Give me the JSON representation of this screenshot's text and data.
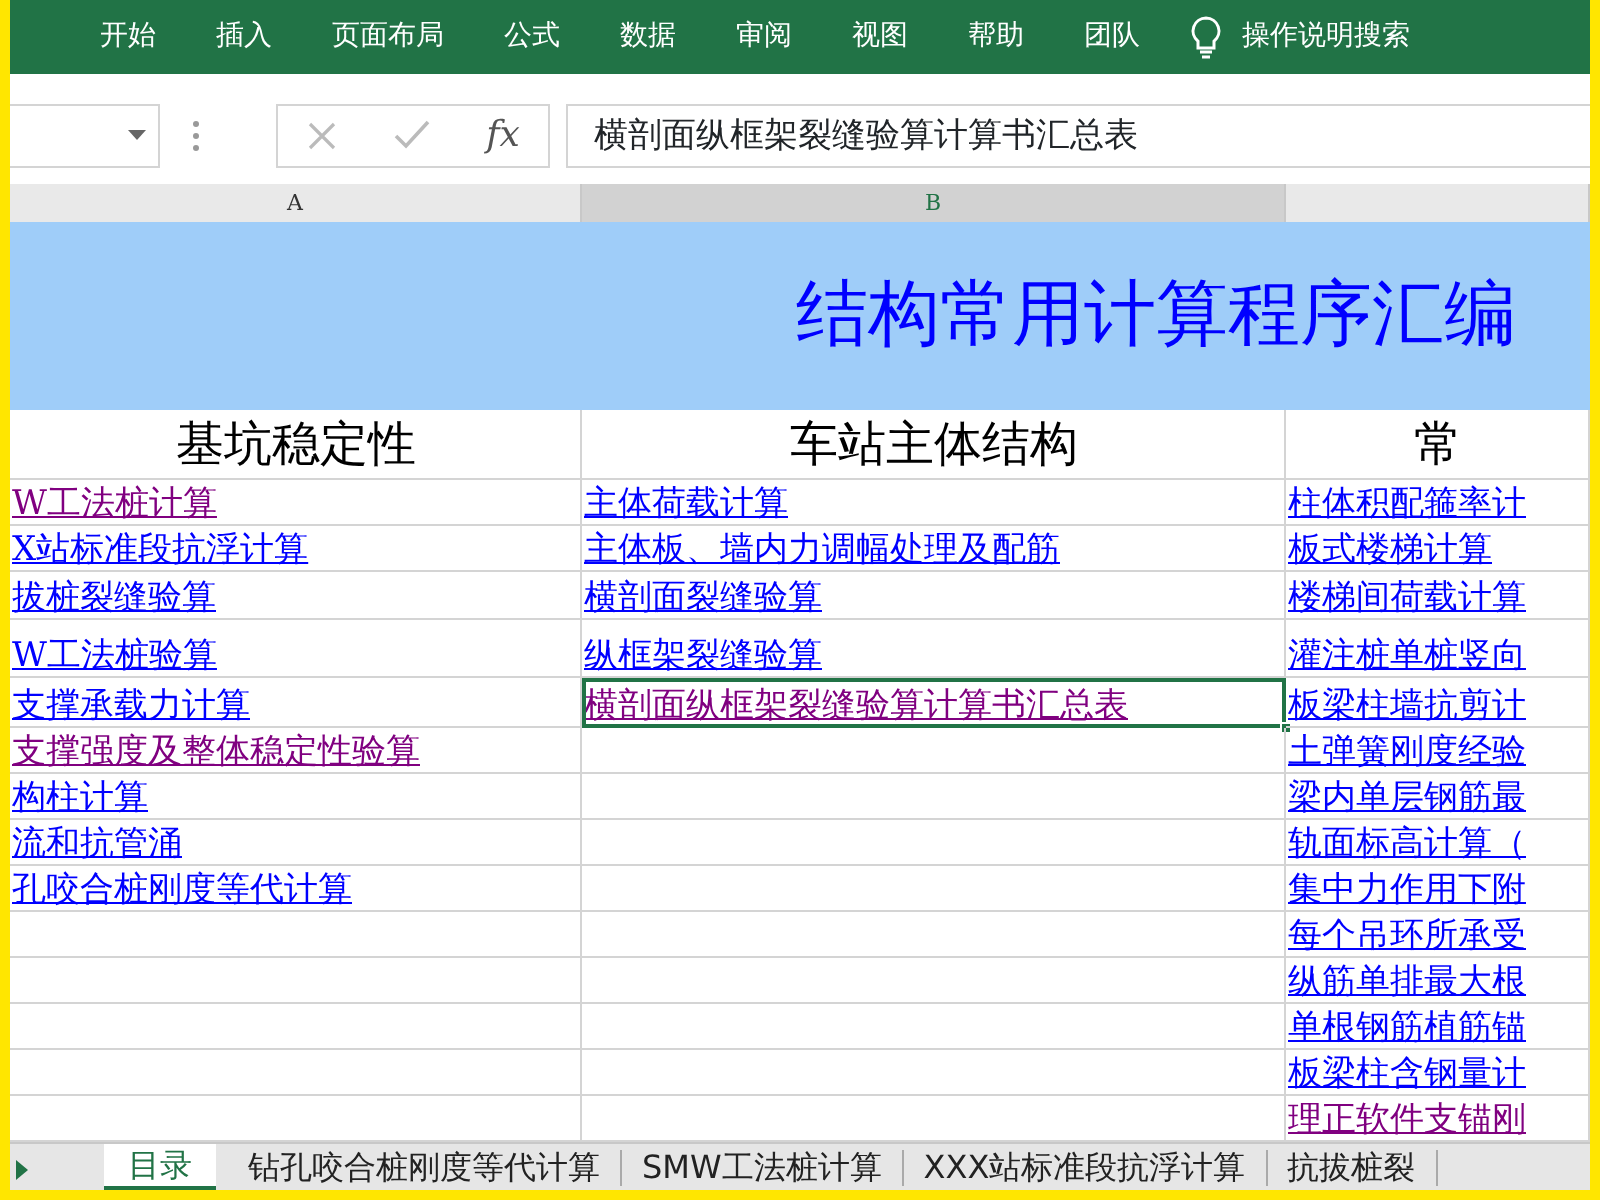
{
  "ribbon": {
    "tabs": [
      {
        "label": "开始"
      },
      {
        "label": "插入"
      },
      {
        "label": "页面布局"
      },
      {
        "label": "公式"
      },
      {
        "label": "数据"
      },
      {
        "label": "审阅"
      },
      {
        "label": "视图"
      },
      {
        "label": "帮助"
      },
      {
        "label": "团队"
      }
    ],
    "search": "操作说明搜索"
  },
  "formula_bar": {
    "function_label": "fx",
    "formula": "横剖面纵框架裂缝验算计算书汇总表"
  },
  "column_headers": [
    {
      "label": "A",
      "selected": false
    },
    {
      "label": "B",
      "selected": true
    }
  ],
  "title": "结构常用计算程序汇编",
  "section_headers": [
    "基坑稳定性",
    "车站主体结构",
    "常"
  ],
  "rows": [
    [
      {
        "text": "W工法桩计算",
        "visited": true,
        "selected": false
      },
      {
        "text": "主体荷载计算",
        "visited": false,
        "selected": false
      },
      {
        "text": "柱体积配箍率计",
        "visited": false,
        "selected": false
      }
    ],
    [
      {
        "text": "X站标准段抗浮计算",
        "visited": false,
        "selected": false
      },
      {
        "text": "主体板、墙内力调幅处理及配筋",
        "visited": false,
        "selected": false
      },
      {
        "text": "板式楼梯计算",
        "visited": false,
        "selected": false
      }
    ],
    [
      {
        "text": "拔桩裂缝验算",
        "visited": false,
        "selected": false
      },
      {
        "text": "横剖面裂缝验算",
        "visited": false,
        "selected": false
      },
      {
        "text": "楼梯间荷载计算",
        "visited": false,
        "selected": false
      }
    ],
    [
      {
        "text": "W工法桩验算",
        "visited": false,
        "selected": false
      },
      {
        "text": "纵框架裂缝验算",
        "visited": false,
        "selected": false
      },
      {
        "text": "灌注桩单桩竖向",
        "visited": false,
        "selected": false
      }
    ],
    [
      {
        "text": "支撑承载力计算",
        "visited": false,
        "selected": false
      },
      {
        "text": "横剖面纵框架裂缝验算计算书汇总表",
        "visited": true,
        "selected": true
      },
      {
        "text": "板梁柱墙抗剪计",
        "visited": false,
        "selected": false
      }
    ],
    [
      {
        "text": "支撑强度及整体稳定性验算",
        "visited": true,
        "selected": false
      },
      null,
      {
        "text": "土弹簧刚度经验",
        "visited": false,
        "selected": false
      }
    ],
    [
      {
        "text": "构柱计算",
        "visited": false,
        "selected": false
      },
      null,
      {
        "text": "梁内单层钢筋最",
        "visited": false,
        "selected": false
      }
    ],
    [
      {
        "text": "流和抗管涌",
        "visited": false,
        "selected": false
      },
      null,
      {
        "text": "轨面标高计算（",
        "visited": false,
        "selected": false
      }
    ],
    [
      {
        "text": "孔咬合桩刚度等代计算",
        "visited": false,
        "selected": false
      },
      null,
      {
        "text": "集中力作用下附",
        "visited": false,
        "selected": false
      }
    ],
    [
      null,
      null,
      {
        "text": "每个吊环所承受",
        "visited": false,
        "selected": false
      }
    ],
    [
      null,
      null,
      {
        "text": "纵筋单排最大根",
        "visited": false,
        "selected": false
      }
    ],
    [
      null,
      null,
      {
        "text": "单根钢筋植筋锚",
        "visited": false,
        "selected": false
      }
    ],
    [
      null,
      null,
      {
        "text": "板梁柱含钢量计",
        "visited": false,
        "selected": false
      }
    ],
    [
      null,
      null,
      {
        "text": "理正软件支锚刚",
        "visited": true,
        "selected": false
      }
    ]
  ],
  "sheet_tabs": [
    {
      "label": "目录",
      "selected": true
    },
    {
      "label": "钻孔咬合桩刚度等代计算",
      "selected": false
    },
    {
      "label": "SMW工法桩计算",
      "selected": false
    },
    {
      "label": "XXX站标准段抗浮计算",
      "selected": false
    },
    {
      "label": "抗拔桩裂",
      "selected": false
    }
  ]
}
